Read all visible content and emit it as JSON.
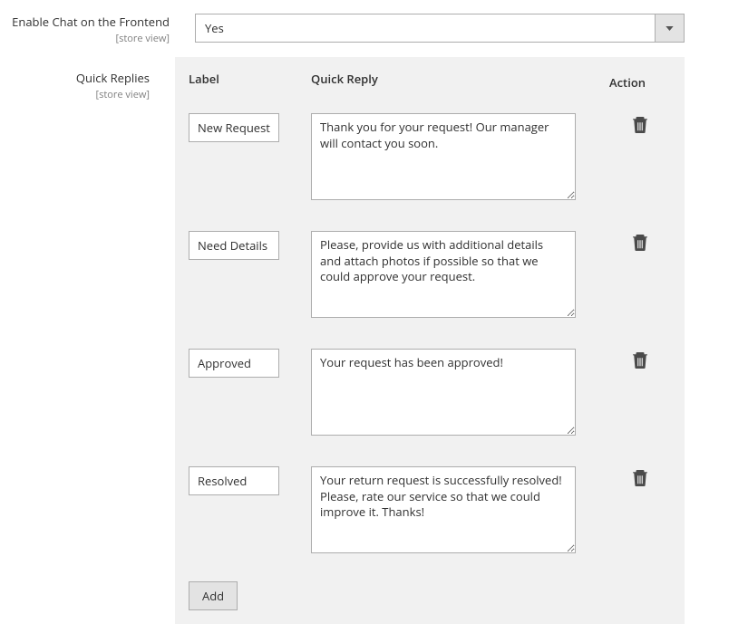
{
  "enable_chat": {
    "label": "Enable Chat on the Frontend",
    "scope": "[store view]",
    "value": "Yes"
  },
  "quick_replies": {
    "label": "Quick Replies",
    "scope": "[store view]",
    "headers": {
      "label": "Label",
      "reply": "Quick Reply",
      "action": "Action"
    },
    "rows": [
      {
        "label": "New Request",
        "reply": "Thank you for your request! Our manager will contact you soon."
      },
      {
        "label": "Need Details",
        "reply": "Please, provide us with additional details and attach photos if possible so that we could approve your request."
      },
      {
        "label": "Approved",
        "reply": "Your request has been approved!"
      },
      {
        "label": "Resolved",
        "reply": "Your return request is successfully resolved! Please, rate our service so that we could improve it. Thanks!"
      }
    ],
    "add_label": "Add"
  }
}
